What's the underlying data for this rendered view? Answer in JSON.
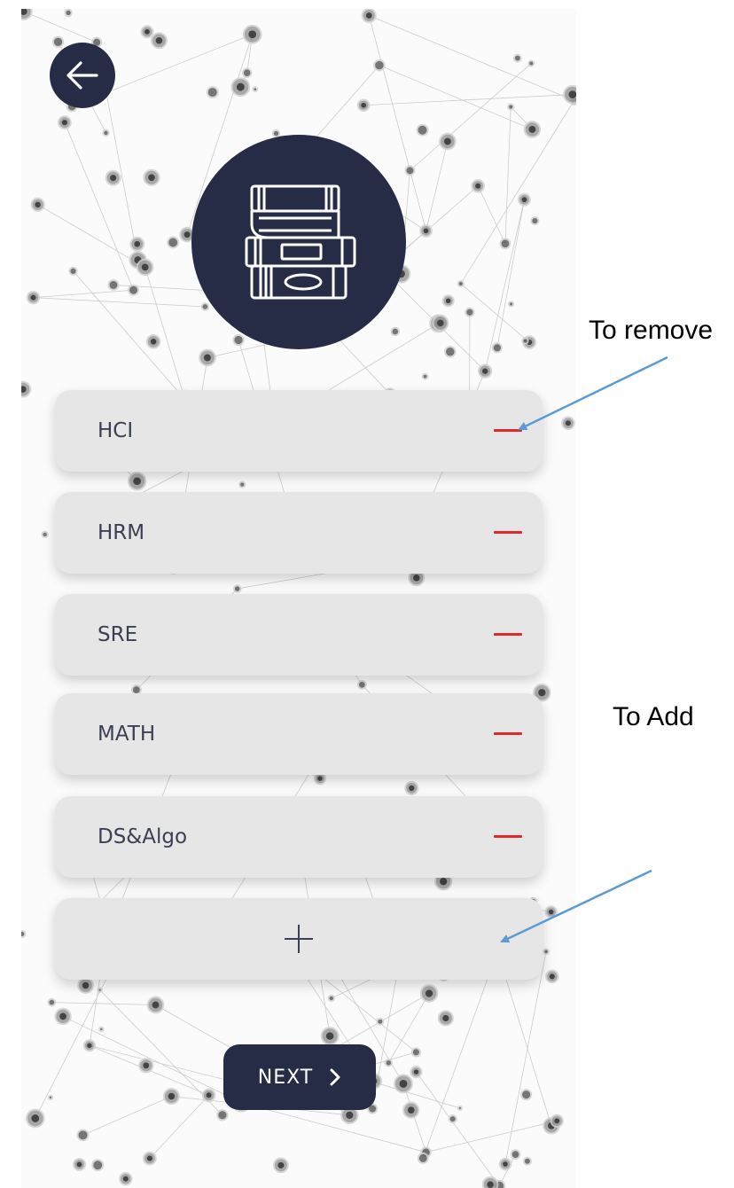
{
  "colors": {
    "navy": "#262c45",
    "row_background": "#e6e6e6",
    "remove": "#e02a2a",
    "text": "#3b3f55",
    "annotation_arrow": "#5b9bd5"
  },
  "header": {
    "back_icon": "arrow-left-icon",
    "hero_icon": "stacked-books-icon"
  },
  "subjects": [
    {
      "label": "HCI",
      "action_icon": "minus-icon"
    },
    {
      "label": "HRM",
      "action_icon": "minus-icon"
    },
    {
      "label": "SRE",
      "action_icon": "minus-icon"
    },
    {
      "label": "MATH",
      "action_icon": "minus-icon"
    },
    {
      "label": "DS&Algo",
      "action_icon": "minus-icon"
    }
  ],
  "add_button": {
    "icon": "plus-icon"
  },
  "next_button": {
    "label": "NEXT",
    "icon": "chevron-right-icon"
  },
  "annotations": {
    "remove": "To remove",
    "add": "To Add"
  }
}
